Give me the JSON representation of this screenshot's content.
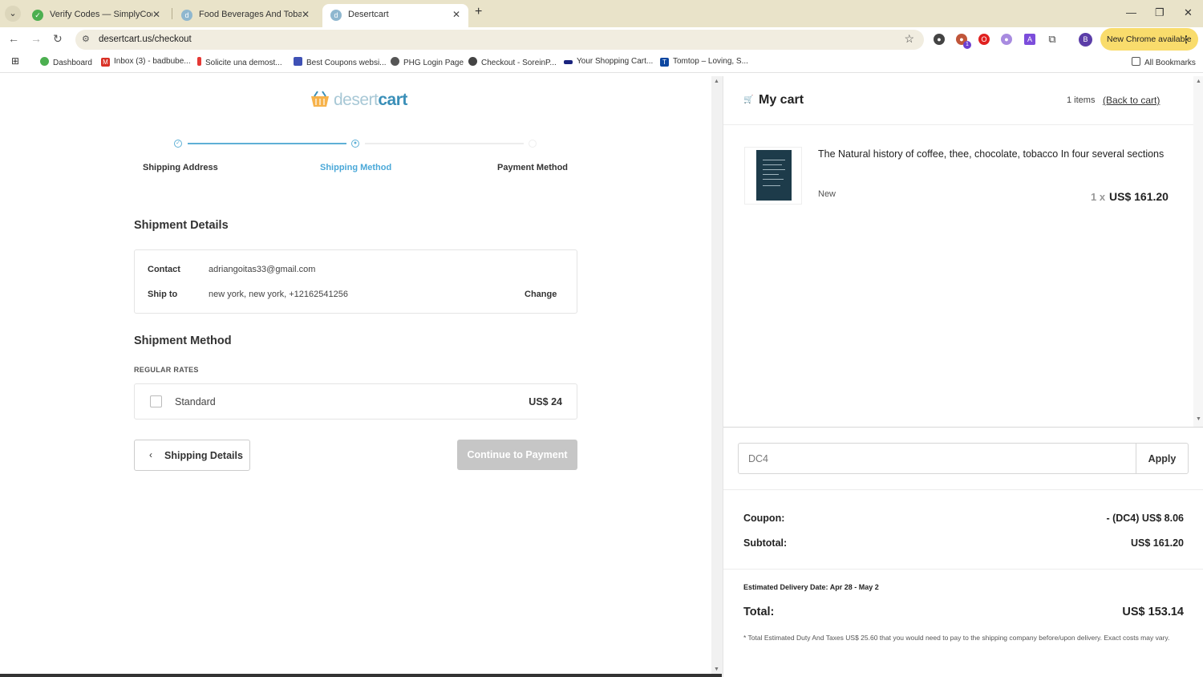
{
  "browser": {
    "tabs": [
      {
        "title": "Verify Codes — SimplyCodes",
        "icon": "simplycodes-icon"
      },
      {
        "title": "Food Beverages And Tobacco P",
        "icon": "desertcart-icon"
      },
      {
        "title": "Desertcart",
        "icon": "desertcart-icon"
      }
    ],
    "url": "desertcart.us/checkout",
    "new_chrome_label": "New Chrome available",
    "profile_initial": "B",
    "extension_badge": "1",
    "bookmarks": [
      {
        "label": "Dashboard",
        "color": "#4caf50"
      },
      {
        "label": "Inbox (3) - badbube...",
        "color": "#d93025"
      },
      {
        "label": "Solicite una demost...",
        "color": "#e53935"
      },
      {
        "label": "Best Coupons websi...",
        "color": "#3f51b5"
      },
      {
        "label": "PHG Login Page",
        "color": "#555555"
      },
      {
        "label": "Checkout - SoreinP...",
        "color": "#444444"
      },
      {
        "label": "Your Shopping Cart...",
        "color": "#1a237e"
      },
      {
        "label": "Tomtop – Loving, S...",
        "color": "#0d47a1"
      }
    ],
    "all_bookmarks_label": "All Bookmarks"
  },
  "checkout": {
    "logo": {
      "part1": "desert",
      "part2": "cart"
    },
    "steps": [
      {
        "label": "Shipping Address",
        "state": "done"
      },
      {
        "label": "Shipping Method",
        "state": "active"
      },
      {
        "label": "Payment Method",
        "state": "pending"
      }
    ],
    "shipment_details_title": "Shipment Details",
    "contact_label": "Contact",
    "contact_value": "adriangoitas33@gmail.com",
    "ship_to_label": "Ship to",
    "ship_to_value": "new york, new york, +12162541256",
    "change_label": "Change",
    "shipment_method_title": "Shipment Method",
    "rates_title": "REGULAR RATES",
    "option": {
      "name": "Standard",
      "price": "US$ 24",
      "selected": false
    },
    "back_button": "Shipping Details",
    "continue_button": "Continue to Payment"
  },
  "cart": {
    "title": "My cart",
    "count": "1 items",
    "back_link": "(Back to cart)",
    "item": {
      "title": "The Natural history of coffee, thee, chocolate, tobacco In four several sections",
      "condition": "New",
      "qty": "1 x",
      "price": "US$ 161.20"
    },
    "coupon_code": "DC4",
    "apply_label": "Apply",
    "coupon_label": "Coupon:",
    "coupon_value": "- (DC4) US$ 8.06",
    "subtotal_label": "Subtotal:",
    "subtotal_value": "US$ 161.20",
    "delivery": "Estimated Delivery Date: Apr 28 - May 2",
    "total_label": "Total:",
    "total_value": "US$ 153.14",
    "note": "* Total Estimated Duty And Taxes US$ 25.60 that you would need to pay to the shipping company before/upon delivery. Exact costs may vary."
  }
}
